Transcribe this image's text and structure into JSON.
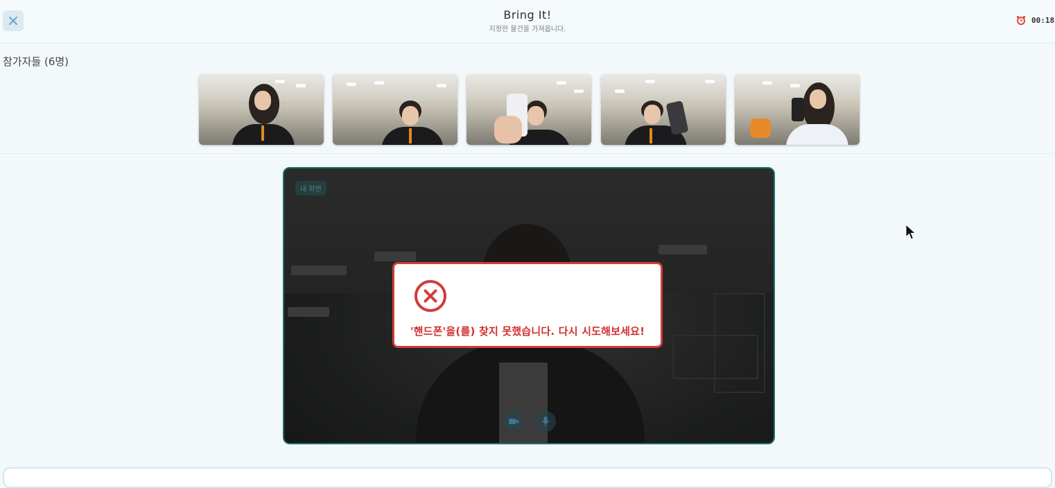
{
  "header": {
    "title": "Bring It!",
    "subtitle": "지정한 물건을 가져옵니다.",
    "timer": "00:18",
    "close_icon": "close-icon",
    "timer_icon": "alarm-clock-icon"
  },
  "participants": {
    "heading": "참가자들 (6명)",
    "count": 5
  },
  "camera": {
    "self_label": "내 화면",
    "controls": [
      "camera-icon",
      "microphone-icon"
    ]
  },
  "modal": {
    "icon": "error-x-icon",
    "message": "'핸드폰'을(를) 찾지 못했습니다. 다시 시도해보세요!"
  },
  "colors": {
    "accent_teal": "#1f6f6c",
    "error_red": "#d33b3b",
    "background": "#f3f9fb"
  }
}
